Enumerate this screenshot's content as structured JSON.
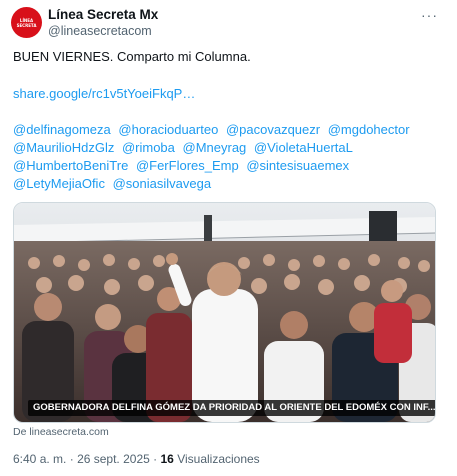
{
  "author": {
    "display_name": "Línea Secreta Mx",
    "handle": "@lineasecretacom",
    "avatar_text": "LÍNEA SECRETA"
  },
  "more_icon": "···",
  "tweet": {
    "text": "BUEN VIERNES. Comparto mi Columna.",
    "link": "share.google/rc1v5tYoeiFkqP…",
    "mentions": [
      "@delfinagomeza",
      "@horacioduarteo",
      "@pacovazquezr",
      "@mgdohector",
      "@MaurilioHdzGlz",
      "@rimoba",
      "@Mneyrag",
      "@VioletaHuertaL",
      "@HumbertoBeniTre",
      "@FerFlores_Emp",
      "@sintesisuaemex",
      "@LetyMejiaOfic",
      "@soniasilvavega"
    ]
  },
  "media": {
    "caption": "GOBERNADORA DELFINA GÓMEZ DA PRIORIDAD AL ORIENTE DEL EDOMÉX CON INF..."
  },
  "source": "De lineasecreta.com",
  "meta": {
    "time": "6:40 a. m.",
    "separator": "·",
    "date": "26 sept. 2025",
    "views_count": "16",
    "views_label": "Visualizaciones"
  },
  "colors": {
    "link": "#1d9bf0",
    "text": "#0f1419",
    "secondary": "#536471",
    "avatar_red": "#d8101a"
  }
}
